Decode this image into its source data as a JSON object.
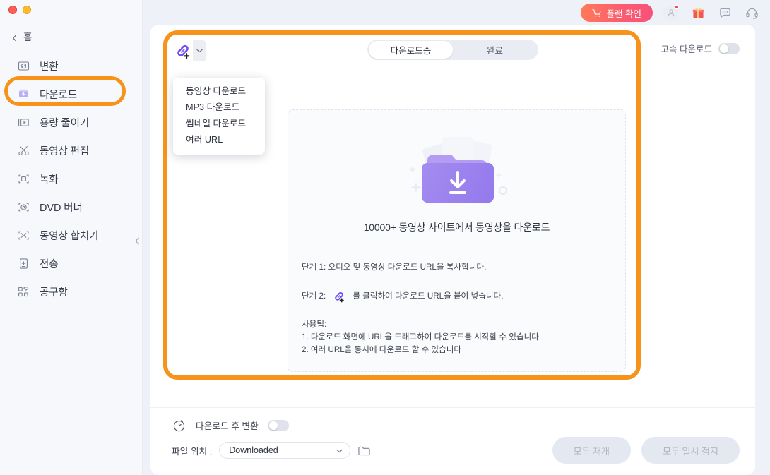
{
  "window": {
    "traffic_lights": [
      "close",
      "minimize"
    ]
  },
  "sidebar": {
    "back": {
      "label": "홈",
      "icon": "chevron-left-icon"
    },
    "items": [
      {
        "label": "변환",
        "icon": "convert-icon",
        "active": false
      },
      {
        "label": "다운로드",
        "icon": "download-icon",
        "active": true
      },
      {
        "label": "용량 줄이기",
        "icon": "compress-icon",
        "active": false
      },
      {
        "label": "동영상 편집",
        "icon": "scissors-icon",
        "active": false
      },
      {
        "label": "녹화",
        "icon": "record-icon",
        "active": false
      },
      {
        "label": "DVD 버너",
        "icon": "disc-icon",
        "active": false
      },
      {
        "label": "동영상 합치기",
        "icon": "merge-icon",
        "active": false
      },
      {
        "label": "전송",
        "icon": "transfer-icon",
        "active": false
      },
      {
        "label": "공구함",
        "icon": "toolbox-icon",
        "active": false
      }
    ],
    "collapse": {
      "icon": "chevron-left-icon"
    }
  },
  "header": {
    "plan_button": {
      "label": "플랜 확인",
      "icon": "cart-icon",
      "color": "#fb5d6e"
    },
    "icons": [
      {
        "name": "account-icon",
        "badge": true
      },
      {
        "name": "gift-icon",
        "badge": false
      },
      {
        "name": "feedback-icon",
        "badge": false
      },
      {
        "name": "support-icon",
        "badge": false
      }
    ]
  },
  "toolbar": {
    "add_url_button": {
      "icon": "link-plus-icon",
      "caret": "chevron-down-icon"
    },
    "dropdown": {
      "open": true,
      "items": [
        "동영상 다운로드",
        "MP3 다운로드",
        "썸네일 다운로드",
        "여러 URL"
      ]
    },
    "tabs": [
      {
        "label": "다운로드중",
        "active": true
      },
      {
        "label": "완료",
        "active": false
      }
    ],
    "fast_download": {
      "label": "고속 다운로드",
      "enabled": false
    }
  },
  "dropzone": {
    "illustration": "download-folder-illustration",
    "title": "10000+ 동영상 사이트에서 동영상을 다운로드",
    "step1_prefix": "단계 1: 오디오 및 동영상 다운로드 URL을 복사합니다.",
    "step2_prefix": "단계 2:",
    "step2_suffix": "를 클릭하여 다운로드 URL을 붙여 넣습니다.",
    "step2_icon": "link-plus-icon",
    "tips_title": "사용팁:",
    "tips": [
      "1. 다운로드 화면에 URL을 드래그하여 다운로드를 시작할 수 있습니다.",
      "2. 여러 URL을 동시에 다운로드 할 수 있습니다"
    ]
  },
  "bottom": {
    "convert_after": {
      "label": "다운로드 후 변환",
      "enabled": false,
      "icon": "timer-icon"
    },
    "file_location": {
      "label": "파일 위치 :",
      "value": "Downloaded",
      "caret": "chevron-down-icon",
      "browse_icon": "folder-icon"
    },
    "resume_all": "모두 재개",
    "pause_all": "모두 일시 정지"
  },
  "annotations": {
    "ring_color": "#f7931b",
    "ring_nav_target": "다운로드",
    "ring_panel_target": "download-panel"
  }
}
